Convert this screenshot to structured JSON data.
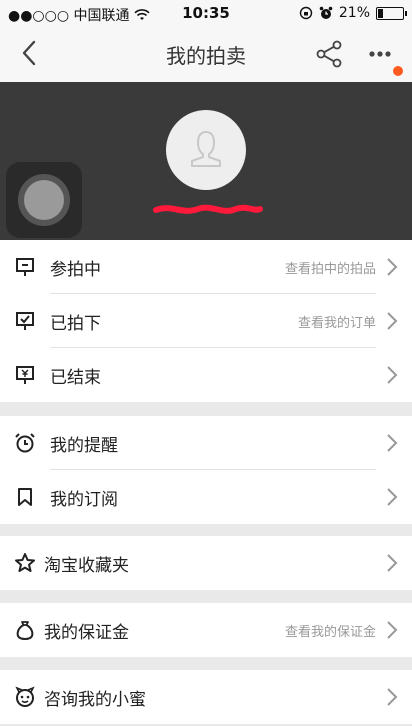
{
  "status_bar": {
    "carrier": "●●○○○ 中国联通",
    "time": "10:35",
    "battery": "21%",
    "battery_level": 0.21
  },
  "nav": {
    "title": "我的拍卖",
    "has_notification": true
  },
  "colors": {
    "accent": "#ff5a1f",
    "header_bg": "#3a3a3a"
  },
  "group1": [
    {
      "label": "参拍中",
      "hint": "查看拍中的拍品",
      "icon": "bidding-icon"
    },
    {
      "label": "已拍下",
      "hint": "查看我的订单",
      "icon": "won-icon"
    },
    {
      "label": "已结束",
      "hint": "",
      "icon": "ended-icon"
    }
  ],
  "group2": [
    {
      "label": "我的提醒",
      "icon": "alarm-icon"
    },
    {
      "label": "我的订阅",
      "icon": "bookmark-icon"
    }
  ],
  "group3": [
    {
      "label": "淘宝收藏夹",
      "icon": "star-icon"
    }
  ],
  "group4": [
    {
      "label": "我的保证金",
      "hint": "查看我的保证金",
      "icon": "money-bag-icon"
    }
  ],
  "group5": [
    {
      "label": "咨询我的小蜜",
      "icon": "assistant-face-icon"
    }
  ]
}
